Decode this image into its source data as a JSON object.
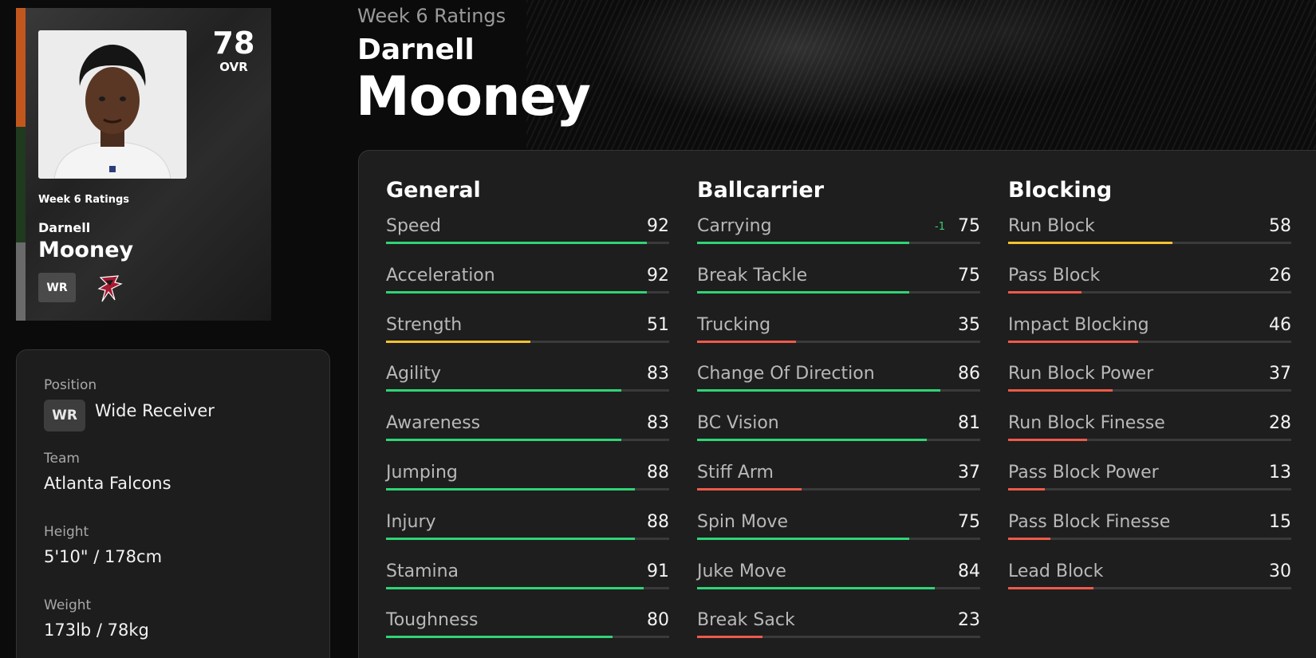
{
  "colors": {
    "green": "#2fd476",
    "yellow": "#f2c230",
    "red": "#ee5a4a"
  },
  "card": {
    "ovr": "78",
    "ovr_label": "OVR",
    "week": "Week 6 Ratings",
    "first_name": "Darnell",
    "last_name": "Mooney",
    "position": "WR",
    "team_logo": "falcons-logo-icon"
  },
  "header": {
    "week": "Week 6 Ratings",
    "first_name": "Darnell",
    "last_name": "Mooney"
  },
  "info": {
    "position_label": "Position",
    "position_abbr": "WR",
    "position_value": "Wide Receiver",
    "team_label": "Team",
    "team_value": "Atlanta Falcons",
    "height_label": "Height",
    "height_value": "5'10\" / 178cm",
    "weight_label": "Weight",
    "weight_value": "173lb / 78kg"
  },
  "ratings": {
    "general": {
      "title": "General",
      "stats": [
        {
          "name": "Speed",
          "value": 92
        },
        {
          "name": "Acceleration",
          "value": 92
        },
        {
          "name": "Strength",
          "value": 51
        },
        {
          "name": "Agility",
          "value": 83
        },
        {
          "name": "Awareness",
          "value": 83
        },
        {
          "name": "Jumping",
          "value": 88
        },
        {
          "name": "Injury",
          "value": 88
        },
        {
          "name": "Stamina",
          "value": 91
        },
        {
          "name": "Toughness",
          "value": 80
        }
      ]
    },
    "ballcarrier": {
      "title": "Ballcarrier",
      "stats": [
        {
          "name": "Carrying",
          "value": 75,
          "delta": "-1"
        },
        {
          "name": "Break Tackle",
          "value": 75
        },
        {
          "name": "Trucking",
          "value": 35
        },
        {
          "name": "Change Of Direction",
          "value": 86
        },
        {
          "name": "BC Vision",
          "value": 81
        },
        {
          "name": "Stiff Arm",
          "value": 37
        },
        {
          "name": "Spin Move",
          "value": 75
        },
        {
          "name": "Juke Move",
          "value": 84
        },
        {
          "name": "Break Sack",
          "value": 23
        }
      ]
    },
    "blocking": {
      "title": "Blocking",
      "stats": [
        {
          "name": "Run Block",
          "value": 58
        },
        {
          "name": "Pass Block",
          "value": 26
        },
        {
          "name": "Impact Blocking",
          "value": 46
        },
        {
          "name": "Run Block Power",
          "value": 37
        },
        {
          "name": "Run Block Finesse",
          "value": 28
        },
        {
          "name": "Pass Block Power",
          "value": 13
        },
        {
          "name": "Pass Block Finesse",
          "value": 15
        },
        {
          "name": "Lead Block",
          "value": 30
        }
      ]
    }
  }
}
